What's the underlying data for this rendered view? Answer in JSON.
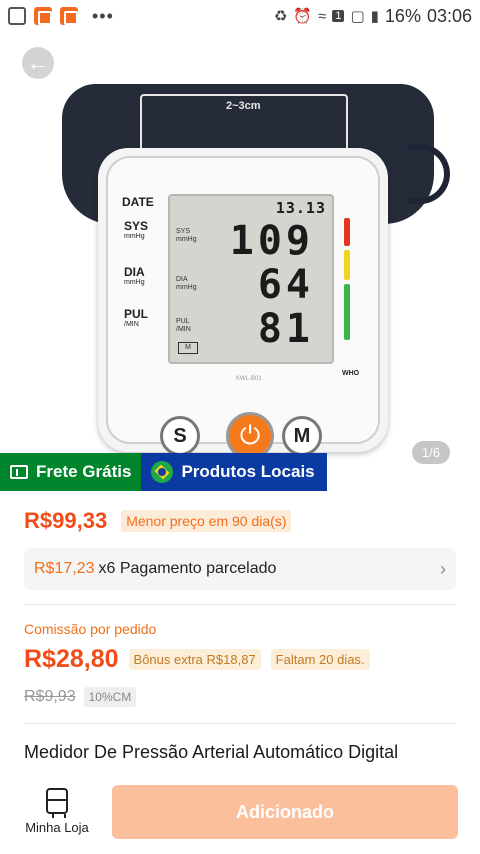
{
  "status_bar": {
    "battery": "16%",
    "time": "03:06",
    "icons": [
      "gallery-icon",
      "app-icon",
      "app-icon",
      "more-icon",
      "recycle-icon",
      "alarm-icon",
      "wifi-icon",
      "sim-icon",
      "signal-icon",
      "signal-icon",
      "battery-icon"
    ],
    "sim_number": "1",
    "more": "•••"
  },
  "product_image": {
    "counter": "1/6",
    "cuff_label": "2~3cm",
    "lcd": {
      "date_label": "DATE",
      "date_value": "13.13",
      "sys_label": "SYS",
      "sys_unit": "mmHg",
      "sys_value": "109",
      "dia_label": "DIA",
      "dia_unit": "mmHg",
      "dia_value": "64",
      "pul_label": "PUL",
      "pul_unit": "/MIN",
      "pul_value": "81",
      "who_label": "WHO",
      "model": "KWL-B01"
    },
    "buttons": {
      "s_label": "S",
      "m_label": "M"
    }
  },
  "badges": {
    "shipping": "Frete Grátis",
    "local": "Produtos Locais"
  },
  "pricing": {
    "price": "R$99,33",
    "lowest_tag": "Menor preço em 90 dia(s)",
    "installment_amount": "R$17,23",
    "installment_text": "x6 Pagamento parcelado",
    "commission_label": "Comissão por pedido",
    "commission_value": "R$28,80",
    "bonus_tag": "Bônus extra R$18,87",
    "days_tag": "Faltam 20 dias.",
    "old_price": "R$9,93",
    "cm_tag": "10%CM"
  },
  "title": "Medidor De Pressão Arterial Automático Digital",
  "bottom": {
    "store_label": "Minha Loja",
    "add_button": "Adicionado"
  },
  "colors": {
    "accent": "#f26f1a",
    "price": "#f24c1b",
    "green_badge": "#00852c",
    "blue_badge": "#0b3aa3",
    "button_disabled": "#fbbf9b"
  }
}
